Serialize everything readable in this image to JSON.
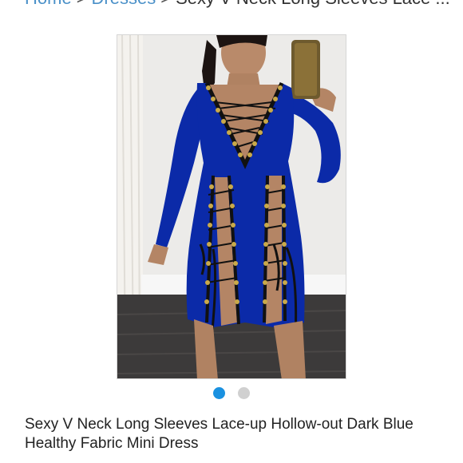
{
  "breadcrumb": {
    "home": "Home",
    "separator": ">",
    "category": "Dresses",
    "current": "Sexy V Neck Long Sleeves Lace ..."
  },
  "gallery": {
    "image_alt": "Woman taking a mirror selfie in a dark blue lace-up mini dress",
    "dots": [
      {
        "state": "active"
      },
      {
        "state": "inactive"
      }
    ],
    "colors": {
      "dress": "#0b2aa8",
      "lace": "#111111",
      "grommet": "#c9a94a",
      "active_dot": "#1a91e0",
      "inactive_dot": "#d0d0d0"
    }
  },
  "product": {
    "title": "Sexy V Neck Long Sleeves Lace-up Hollow-out Dark Blue Healthy Fabric Mini Dress"
  }
}
